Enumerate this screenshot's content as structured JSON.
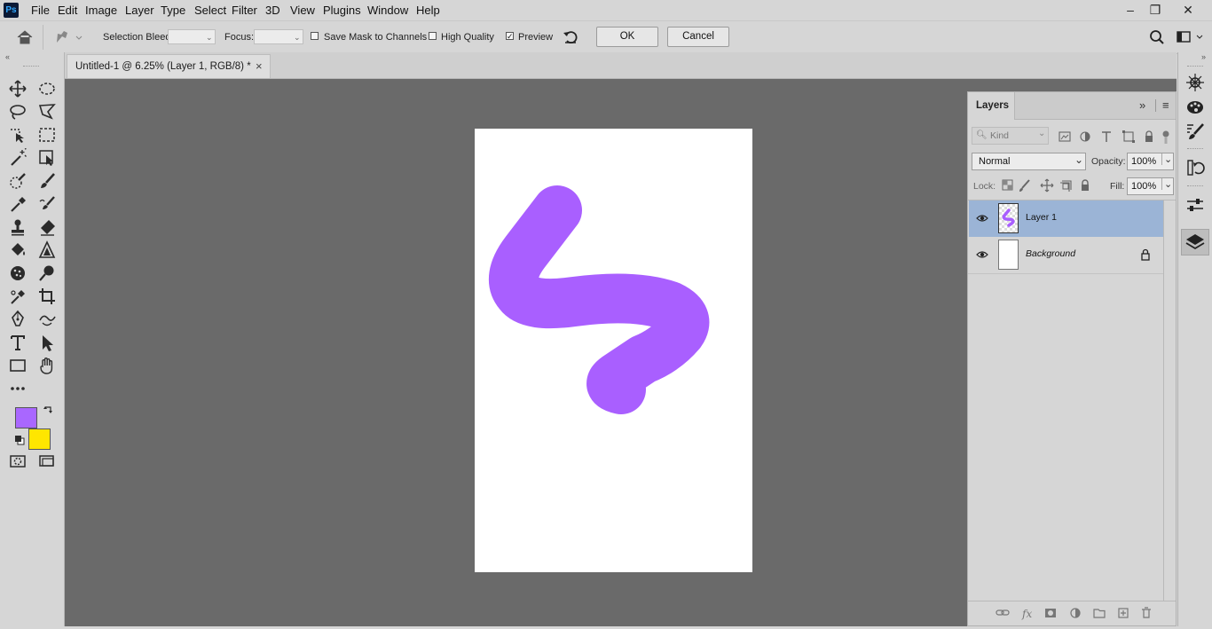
{
  "app": {
    "logo": "Ps"
  },
  "menu": [
    "File",
    "Edit",
    "Image",
    "Layer",
    "Type",
    "Select",
    "Filter",
    "3D",
    "View",
    "Plugins",
    "Window",
    "Help"
  ],
  "window_controls": {
    "minimize": "–",
    "restore": "❐",
    "close": "✕"
  },
  "options": {
    "selection_bleed_label": "Selection Bleed:",
    "focus_label": "Focus:",
    "save_mask_label": "Save Mask to Channels",
    "save_mask_checked": false,
    "high_quality_label": "High Quality",
    "high_quality_checked": false,
    "preview_label": "Preview",
    "preview_checked": true,
    "ok_label": "OK",
    "cancel_label": "Cancel"
  },
  "document": {
    "tab_title": "Untitled-1 @ 6.25% (Layer 1, RGB/8) *",
    "close_glyph": "×"
  },
  "colors": {
    "foreground": "#a967ff",
    "background": "#ffe600",
    "stroke": "#a95fff",
    "selected_layer": "#9bb4d6"
  },
  "layers_panel": {
    "title": "Layers",
    "kind_placeholder": "Kind",
    "blend_mode": "Normal",
    "opacity_label": "Opacity:",
    "opacity_value": "100%",
    "lock_label": "Lock:",
    "fill_label": "Fill:",
    "fill_value": "100%",
    "layers": [
      {
        "name": "Layer 1",
        "selected": true,
        "visible": true,
        "locked": false
      },
      {
        "name": "Background",
        "selected": false,
        "visible": true,
        "locked": true
      }
    ]
  }
}
